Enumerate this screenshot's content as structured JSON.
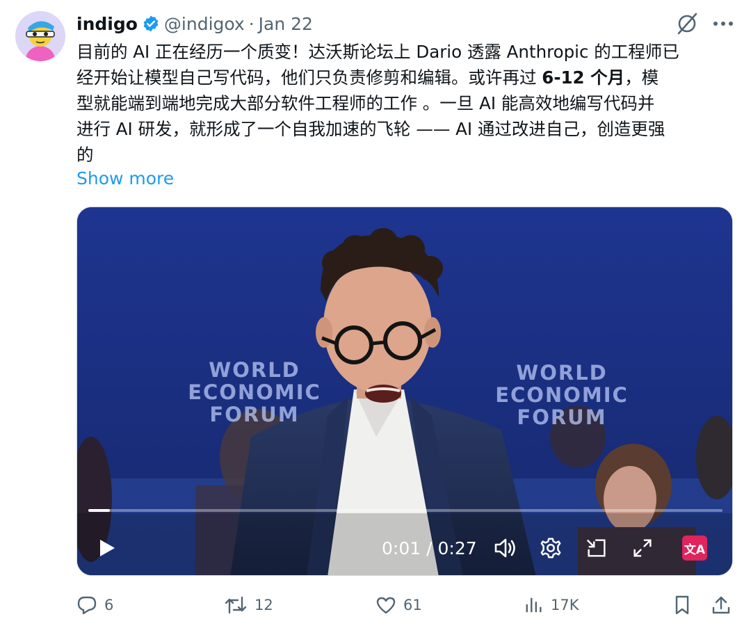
{
  "author": {
    "name": "indigo",
    "handle": "@indigox",
    "separator": "·",
    "date": "Jan 22"
  },
  "body": {
    "line1": "目前的 AI 正在经历一个质变！达沃斯论坛上 Dario 透露 Anthropic 的工程师已",
    "line2_a": "经开始让模型自己写代码，他们只负责修剪和编辑。或许再过 ",
    "line2_bold": "6-12 个月",
    "line2_b": "，模",
    "line3": "型就能端到端地完成大部分软件工程师的工作 。一旦 AI 能高效地编写代码并",
    "line4": "进行 AI 研发，就形成了一个自我加速的飞轮 —— AI 通过改进自己，创造更强",
    "line5": "的",
    "show_more": "Show more"
  },
  "video": {
    "sign_left": [
      "WORLD",
      "ECONOMIC",
      "FORUM"
    ],
    "sign_right": [
      "WORLD",
      "ECONOMIC",
      "FORUM"
    ],
    "current_time": "0:01",
    "time_separator": "/",
    "duration": "0:27",
    "progress_fraction": 0.034,
    "translate_label": "文A"
  },
  "actions": {
    "replies": "6",
    "reposts": "12",
    "likes": "61",
    "views": "17K"
  },
  "colors": {
    "link": "#1d9bf0",
    "muted": "#536471",
    "verified": "#1d9bf0",
    "video_background": "#1b2f86",
    "translate_badge": "#e0245e"
  },
  "icons": [
    "grok-icon",
    "more-icon",
    "verified-icon",
    "play-icon",
    "volume-icon",
    "settings-icon",
    "pip-icon",
    "fullscreen-icon",
    "translate-icon",
    "reply-icon",
    "retweet-icon",
    "like-icon",
    "views-icon",
    "bookmark-icon",
    "share-icon"
  ]
}
